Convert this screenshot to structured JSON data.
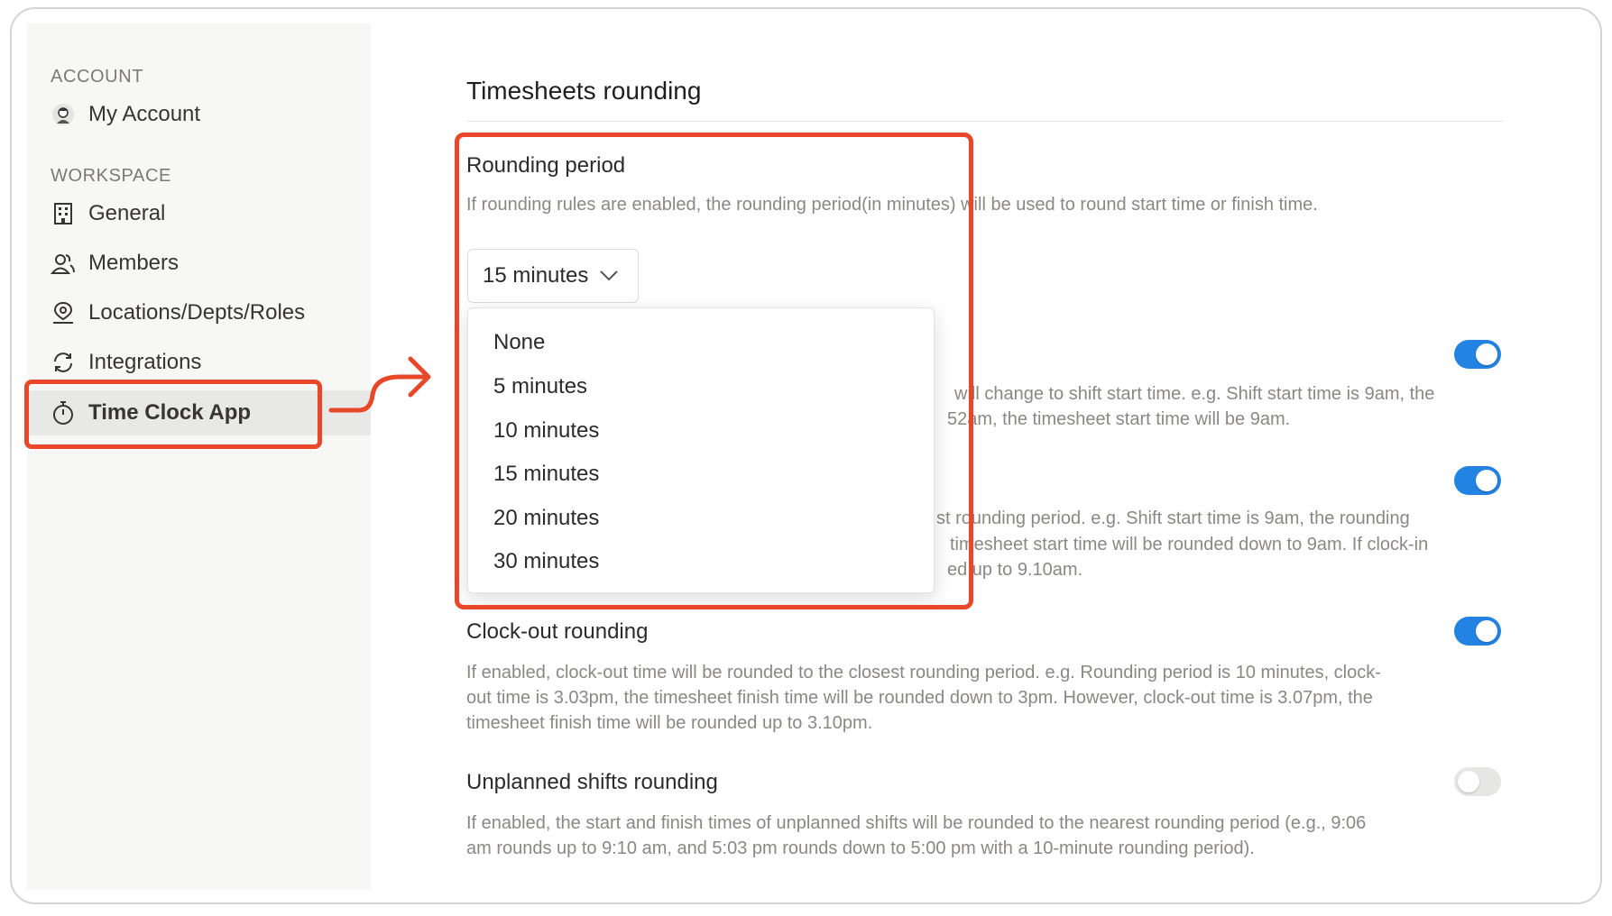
{
  "sidebar": {
    "account_label": "ACCOUNT",
    "workspace_label": "WORKSPACE",
    "items": [
      {
        "label": "My Account",
        "icon": "avatar"
      },
      {
        "label": "General",
        "icon": "building-icon"
      },
      {
        "label": "Members",
        "icon": "members-icon"
      },
      {
        "label": "Locations/Depts/Roles",
        "icon": "location-icon"
      },
      {
        "label": "Integrations",
        "icon": "sync-icon"
      },
      {
        "label": "Time Clock App",
        "icon": "stopwatch-icon",
        "active": true
      }
    ]
  },
  "main": {
    "title": "Timesheets rounding",
    "rounding_period": {
      "title": "Rounding period",
      "description": "If rounding rules are enabled, the rounding period(in minutes) will be used to round start time or finish time.",
      "selected": "15 minutes",
      "options": [
        "None",
        "5 minutes",
        "10 minutes",
        "15 minutes",
        "20 minutes",
        "30 minutes"
      ]
    },
    "hidden_setting_1": {
      "line1": "will change to shift start time. e.g. Shift start time is 9am, the",
      "line2": "52am, the timesheet start time will be 9am.",
      "enabled": true
    },
    "hidden_setting_2": {
      "line1": "st rounding period. e.g. Shift start time is 9am, the rounding",
      "line2": "timesheet start time will be rounded down to 9am. If clock-in",
      "line3": "ed up to 9.10am.",
      "enabled": true
    },
    "clock_out": {
      "title": "Clock-out rounding",
      "line1": "If enabled, clock-out time will be rounded to the closest rounding period. e.g. Rounding period is 10 minutes, clock-",
      "line2": "out time is 3.03pm, the timesheet finish time will be rounded down to 3pm. However, clock-out time is 3.07pm, the",
      "line3": "timesheet finish time will be rounded up to 3.10pm.",
      "enabled": true
    },
    "unplanned": {
      "title": "Unplanned shifts rounding",
      "line1": "If enabled, the start and finish times of unplanned shifts will be rounded to the nearest rounding period (e.g., 9:06",
      "line2": "am rounds up to 9:10 am, and 5:03 pm rounds down to 5:00 pm with a 10-minute rounding period).",
      "enabled": false
    }
  },
  "colors": {
    "accent": "#2383e2",
    "highlight": "#e8472a",
    "sidebar_bg": "#f7f7f5"
  }
}
